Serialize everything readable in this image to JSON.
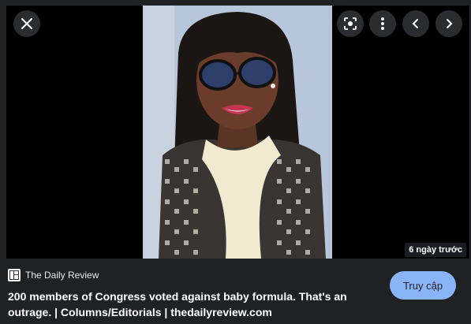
{
  "viewer": {
    "timestamp": "6 ngày trước",
    "visit_label": "Truy cập"
  },
  "source": {
    "name": "The Daily Review",
    "favicon_icon": "newspaper-icon"
  },
  "result": {
    "title": "200 members of Congress voted against baby formula. That's an outrage. | Columns/Editorials | thedailyreview.com"
  },
  "controls": {
    "close_icon": "close-icon",
    "lens_icon": "lens-search-icon",
    "more_icon": "more-vert-icon",
    "prev_icon": "chevron-left-icon",
    "next_icon": "chevron-right-icon"
  },
  "colors": {
    "background": "#202124",
    "accent": "#8ab4f8"
  }
}
